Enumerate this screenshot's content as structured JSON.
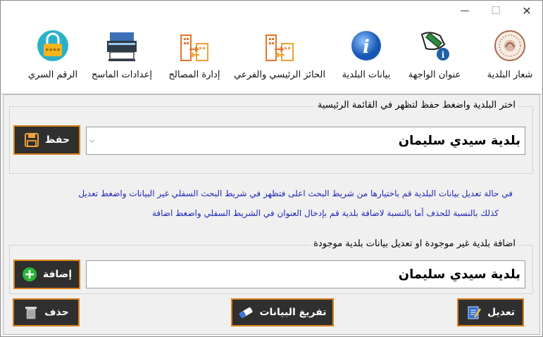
{
  "window": {
    "minimize_glyph": "—",
    "maximize_glyph": "☐",
    "close_glyph": "✕"
  },
  "ribbon": {
    "items": [
      {
        "label": "شعار البلدية",
        "icon": "seal-icon"
      },
      {
        "label": "عنوان الواجهة",
        "icon": "pen-info-icon"
      },
      {
        "label": "بيانات البلدية",
        "icon": "info-icon"
      },
      {
        "label": "الحائز الرئيسي والفرعي",
        "icon": "buildings-transfer-icon"
      },
      {
        "label": "إدارة المصالح",
        "icon": "buildings-transfer-icon"
      },
      {
        "label": "إعدادات الماسح",
        "icon": "scanner-icon"
      },
      {
        "label": "الرقم السري",
        "icon": "lock-password-icon"
      }
    ]
  },
  "select_group": {
    "title": "اختر البلدية واضغط حفظ لتظهر في القائمة الرئيسية",
    "selected_value": "بلدية سيدي سليمان",
    "save_label": "حفظ"
  },
  "info": {
    "line1": "في حالة تعديل بيانات البلدية قم باختيارها من شريط البحث اعلى فتظهر في شريط البحث السفلي غير البيانات واضغط تعديل",
    "line2": "كذلك بالنسبة للحذف أما بالنسبة لاضافة بلدية قم بإدخال العنوان في الشريط السفلي واضغط اضافة"
  },
  "edit_group": {
    "title": "اضافة بلدية غير موجودة او تعديل بيانات بلدية موجودة",
    "input_value": "بلدية سيدي سليمان",
    "add_label": "إضافة",
    "delete_label": "حذف",
    "clear_label": "تفريغ البيانات",
    "edit_label": "تعديل"
  },
  "colors": {
    "button_bg": "#2f2f2f",
    "button_border": "#d9821c",
    "info_text": "#1f26b7",
    "accent_orange": "#e8732c"
  }
}
